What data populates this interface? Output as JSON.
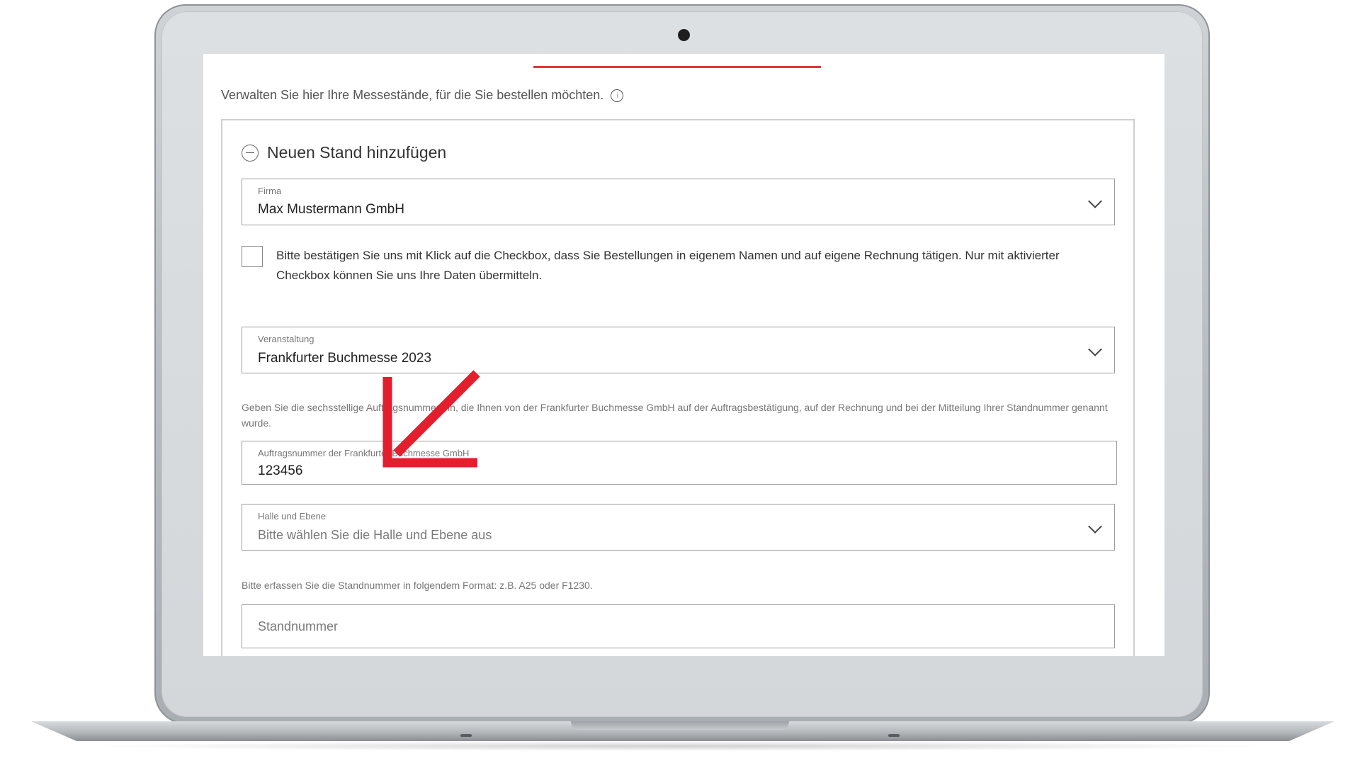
{
  "form": {
    "intro_text": "Verwalten Sie hier Ihre Messestände, für die Sie bestellen möchten.",
    "info_icon": "info-icon",
    "section_title": "Neuen Stand hinzufügen",
    "firma": {
      "label": "Firma",
      "value": "Max Mustermann GmbH"
    },
    "confirm_text": "Bitte bestätigen Sie uns mit Klick auf die Checkbox, dass Sie Bestellungen in eigenem Namen und auf eigene Rechnung tätigen. Nur mit aktivierter Checkbox können Sie uns Ihre Daten übermitteln.",
    "veranstaltung": {
      "label": "Veranstaltung",
      "value": "Frankfurter Buchmesse 2023"
    },
    "order_hint": "Geben Sie die sechsstellige Auftragsnummer ein, die Ihnen von der Frankfurter Buchmesse GmbH auf der Auftragsbestätigung, auf der Rechnung und bei der Mitteilung Ihrer Standnummer genannt wurde.",
    "auftragsnummer": {
      "label": "Auftragsnummer der Frankfurter Buchmesse GmbH",
      "value": "123456"
    },
    "halle": {
      "label": "Halle und Ebene",
      "placeholder": "Bitte wählen Sie die Halle und Ebene aus"
    },
    "stand_hint": "Bitte erfassen Sie die Standnummer in folgendem Format: z.B. A25 oder F1230.",
    "standnummer": {
      "placeholder": "Standnummer"
    }
  },
  "colors": {
    "accent": "#e03a3e",
    "arrow": "#e31e2d"
  }
}
